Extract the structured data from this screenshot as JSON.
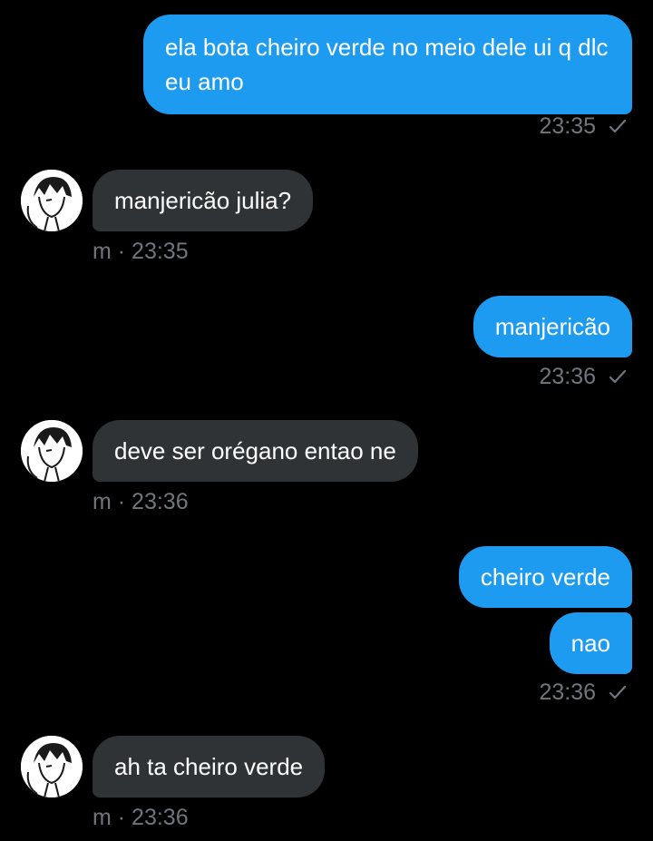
{
  "conversation": {
    "messages": [
      {
        "direction": "sent",
        "text": "ela bota cheiro verde no meio dele ui q dlc eu amo"
      },
      {
        "direction": "received",
        "text": "manjericão julia?",
        "meta": "m · 23:35"
      },
      {
        "direction": "sent",
        "text": "manjericão"
      },
      {
        "direction": "received",
        "text": "deve ser orégano entao ne",
        "meta": "m · 23:36"
      },
      {
        "direction": "sent",
        "text": "cheiro verde"
      },
      {
        "direction": "sent",
        "text": "nao"
      },
      {
        "direction": "received",
        "text": "ah ta cheiro verde",
        "meta": "m · 23:36"
      }
    ],
    "sent_timestamps": [
      "23:35",
      "23:36",
      "23:36"
    ],
    "read_status_icon": "checkmark-icon",
    "contact_avatar_icon": "anime-avatar-icon"
  },
  "colors": {
    "sent_bubble": "#1d9bf0",
    "received_bubble": "#2f3336",
    "meta_text": "#71767b",
    "background": "#000000"
  }
}
